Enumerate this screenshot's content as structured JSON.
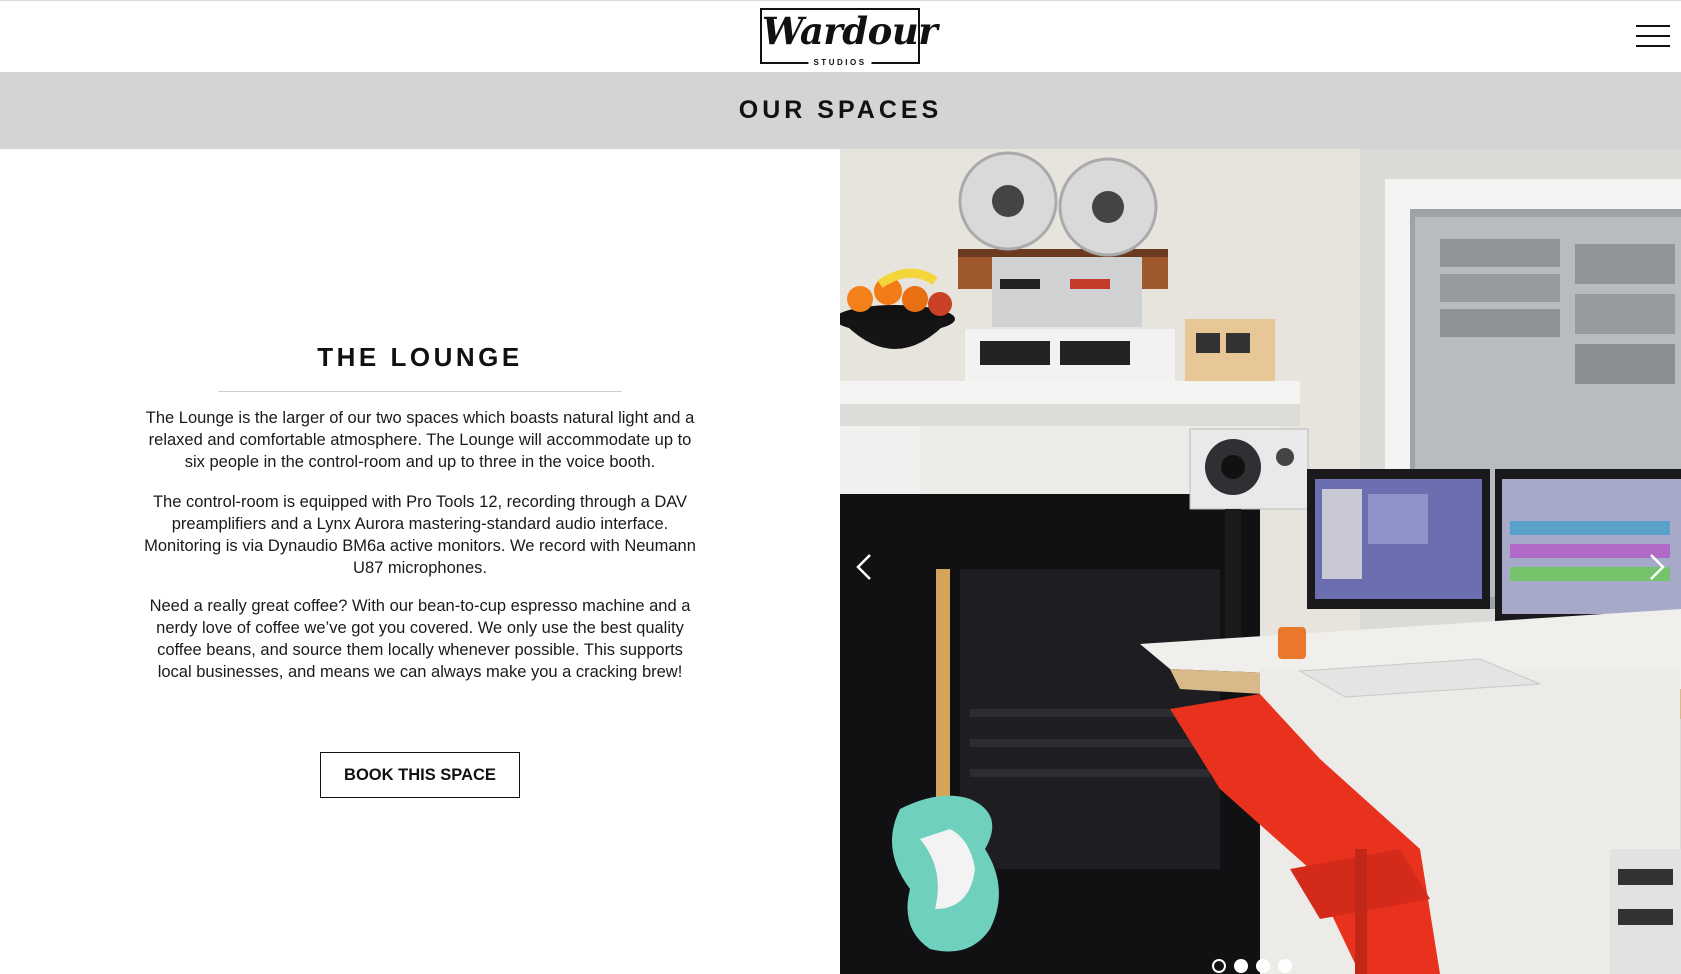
{
  "header": {
    "logo_text": "Wardour",
    "logo_subtext": "STUDIOS"
  },
  "banner": {
    "title": "OUR SPACES"
  },
  "space": {
    "title": "THE LOUNGE",
    "paragraphs": [
      "The Lounge is the larger of our two spaces which boasts natural light and a relaxed and comfortable atmosphere. The Lounge will accommodate up to six people in the control-room and up to three in the voice booth.",
      "The control-room is equipped with Pro Tools 12, recording through a DAV preamplifiers and a Lynx Aurora mastering-standard audio interface. Monitoring is via Dynaudio BM6a active monitors. We record with Neumann U87 microphones.",
      "Need a really great coffee? With our bean-to-cup espresso machine and a nerdy love of coffee we’ve got you covered. We only use the best quality coffee beans, and source them locally whenever possible. This supports local businesses, and  means we can always make you a cracking brew!"
    ],
    "book_button_label": "BOOK THIS SPACE"
  },
  "carousel": {
    "slide_count": 4,
    "active_slide": 1,
    "prev_icon": "chevron-left-icon",
    "next_icon": "chevron-right-icon"
  },
  "colors": {
    "banner_bg": "#d4d4d4",
    "text": "#111111",
    "chair_red": "#e8321e",
    "guitar_teal": "#6fd1bd"
  }
}
